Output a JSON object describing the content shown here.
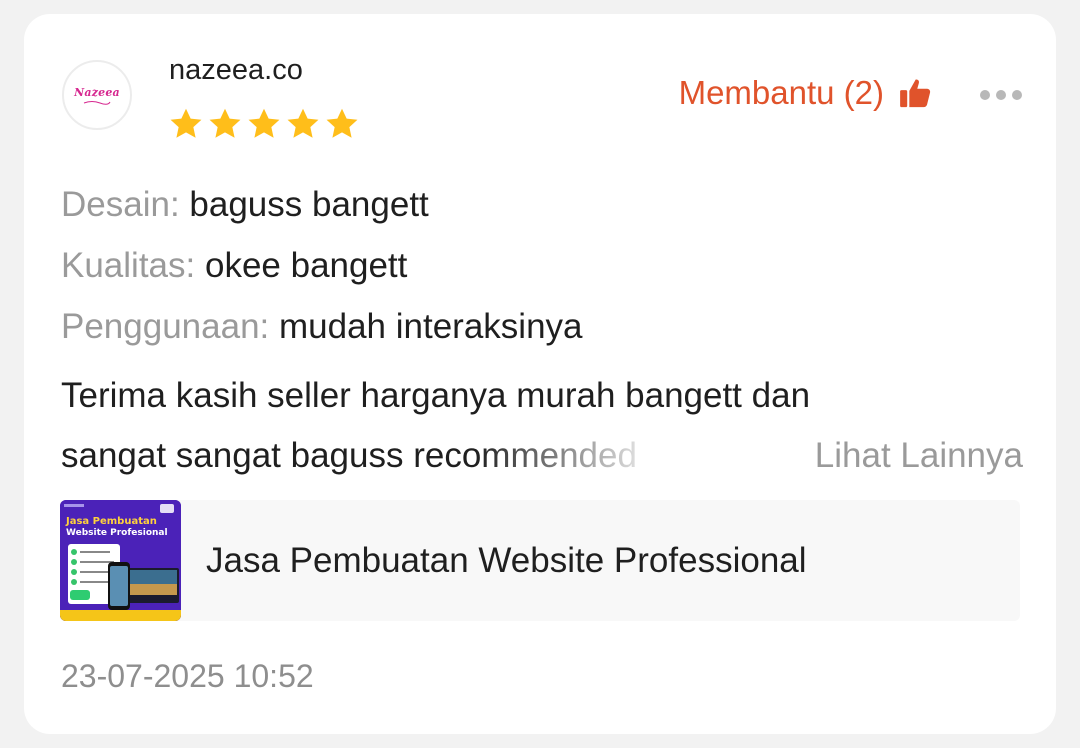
{
  "review": {
    "avatar_logo_text": "Nazeea",
    "username": "nazeea.co",
    "rating": 5,
    "rating_max": 5,
    "helpful": {
      "label": "Membantu (2)",
      "icon": "thumbs-up-icon"
    },
    "more_icon": "more-horizontal-icon",
    "attributes": [
      {
        "label": "Desain:",
        "value": "baguss bangett"
      },
      {
        "label": "Kualitas:",
        "value": "okee bangett"
      },
      {
        "label": "Penggunaan:",
        "value": "mudah interaksinya"
      }
    ],
    "comment_lines": [
      "Terima kasih seller harganya murah bangett dan",
      "sangat sangat baguss recommended"
    ],
    "see_more_label": "Lihat Lainnya",
    "product": {
      "name": "Jasa Pembuatan Website Professional",
      "thumbnail_title_1": "Jasa Pembuatan",
      "thumbnail_title_2": "Website Profesional"
    },
    "timestamp": "23-07-2025 10:52"
  },
  "colors": {
    "accent": "#e0532b",
    "star": "#ffbe1a",
    "muted_text": "#9a9a9a",
    "text": "#1f1f1f",
    "background": "#f2f2f2",
    "card": "#ffffff"
  }
}
